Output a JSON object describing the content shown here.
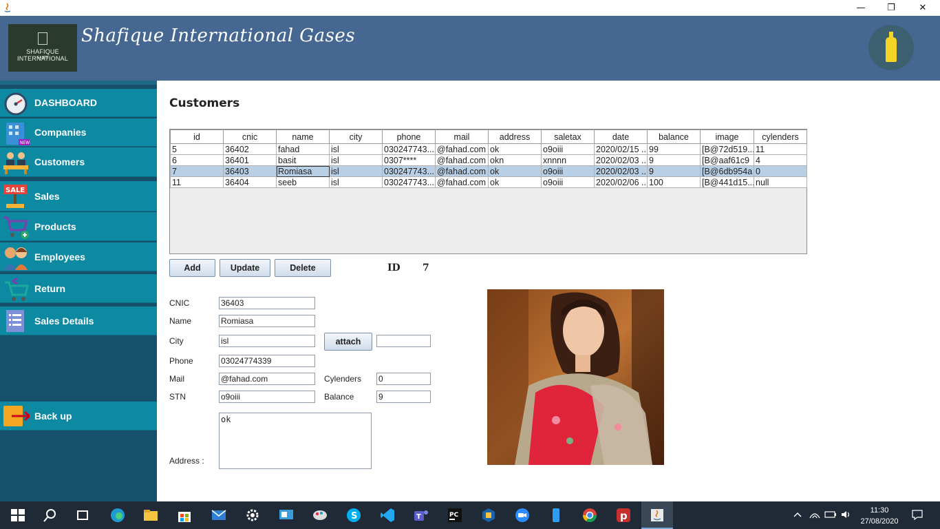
{
  "window": {
    "minimize": "—",
    "restore": "❐",
    "close": "✕"
  },
  "header": {
    "logo_line1": "SHAFIQUE INTERNATIONAL",
    "logo_line2": "GASES",
    "title": "Shafique International Gases"
  },
  "sidebar": {
    "items": [
      {
        "label": "DASHBOARD",
        "icon": "speedometer-icon"
      },
      {
        "label": "Companies",
        "icon": "building-new-icon"
      },
      {
        "label": "Customers",
        "icon": "customers-desk-icon"
      },
      {
        "label": "Sales",
        "icon": "sale-sign-icon"
      },
      {
        "label": "Products",
        "icon": "cart-add-icon"
      },
      {
        "label": "Employees",
        "icon": "people-icon"
      },
      {
        "label": "Return",
        "icon": "cart-return-icon"
      },
      {
        "label": "Sales Details",
        "icon": "list-document-icon"
      }
    ],
    "backup_label": "Back up"
  },
  "main": {
    "title": "Customers",
    "table": {
      "columns": [
        "id",
        "cnic",
        "name",
        "city",
        "phone",
        "mail",
        "address",
        "saletax",
        "date",
        "balance",
        "image",
        "cylenders"
      ],
      "rows": [
        [
          "5",
          "36402",
          "fahad",
          "isl",
          "030247743...",
          "@fahad.com",
          "ok",
          "o9oiii",
          "2020/02/15 ...",
          "99",
          "[B@72d519...",
          "11"
        ],
        [
          "6",
          "36401",
          "basit",
          "isl",
          "0307****",
          "@fahad.com",
          "okn",
          "xnnnn",
          "2020/02/03 ...",
          "9",
          "[B@aaf61c9",
          "4"
        ],
        [
          "7",
          "36403",
          "Romiasa",
          "isl",
          "030247743...",
          "@fahad.com",
          "ok",
          "o9oiii",
          "2020/02/03 ...",
          "9",
          "[B@6db954a",
          "0"
        ],
        [
          "11",
          "36404",
          "seeb",
          "isl",
          "030247743...",
          "@fahad.com",
          "ok",
          "o9oiii",
          "2020/02/06 ...",
          "100",
          "[B@441d15...",
          "null"
        ]
      ],
      "selected_row": 2
    },
    "buttons": {
      "add": "Add",
      "update": "Update",
      "delete": "Delete",
      "attach": "attach"
    },
    "id_label": "ID",
    "id_value": "7",
    "form": {
      "cnic_label": "CNIC",
      "cnic": "36403",
      "name_label": "Name",
      "name": "Romiasa",
      "city_label": "City",
      "city": "isl",
      "attach_path": "",
      "phone_label": "Phone",
      "phone": "03024774339",
      "mail_label": "Mail",
      "mail": "@fahad.com",
      "cylenders_label": "Cylenders",
      "cylenders": "0",
      "stn_label": "STN",
      "stn": "o9oiii",
      "balance_label": "Balance",
      "balance": "9",
      "address_label": "Address :",
      "address": "ok"
    }
  },
  "taskbar": {
    "time": "11:30",
    "date": "27/08/2020"
  },
  "colors": {
    "header": "#456792",
    "sidebar": "#16506a",
    "nav_item": "#0d8aa2",
    "selected_row": "#b8cfe5",
    "taskbar": "#1f2a36"
  }
}
